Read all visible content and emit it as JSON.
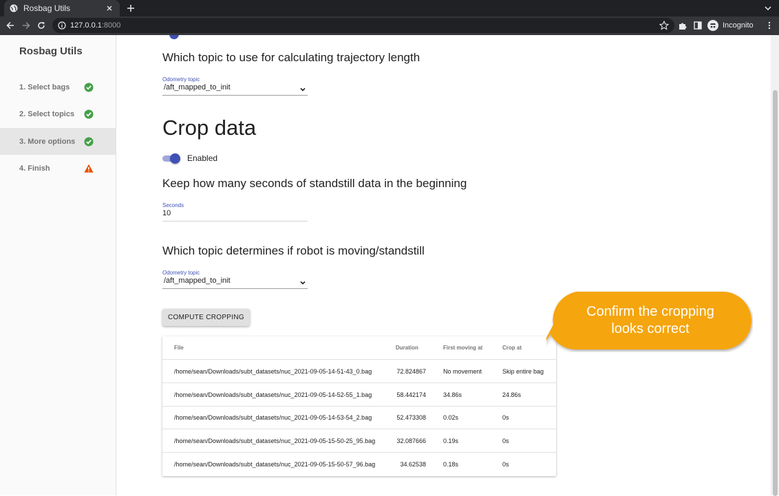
{
  "browser": {
    "tab_title": "Rosbag Utils",
    "url_host": "127.0.0.1",
    "url_port": ":8000",
    "profile_label": "Incognito"
  },
  "sidebar": {
    "title": "Rosbag Utils",
    "steps": [
      {
        "label": "1. Select bags",
        "status": "complete",
        "icon": "check-circle-icon",
        "color": "#43a047"
      },
      {
        "label": "2. Select topics",
        "status": "complete",
        "icon": "check-circle-icon",
        "color": "#43a047"
      },
      {
        "label": "3. More options",
        "status": "complete",
        "icon": "check-circle-icon",
        "color": "#43a047",
        "active": true
      },
      {
        "label": "4. Finish",
        "status": "warning",
        "icon": "warning-icon",
        "color": "#e65100"
      }
    ]
  },
  "main": {
    "trajectory_heading": "Which topic to use for calculating trajectory length",
    "trajectory_select": {
      "label": "Odometry topic",
      "value": "/aft_mapped_to_init"
    },
    "crop_heading": "Crop data",
    "crop_toggle": {
      "label": "Enabled",
      "checked": true
    },
    "standstill_heading": "Keep how many seconds of standstill data in the beginning",
    "seconds_field": {
      "label": "Seconds",
      "value": "10"
    },
    "moving_heading": "Which topic determines if robot is moving/standstill",
    "moving_select": {
      "label": "Odometry topic",
      "value": "/aft_mapped_to_init"
    },
    "compute_button": "COMPUTE CROPPING",
    "table": {
      "headers": {
        "file": "File",
        "duration": "Duration",
        "first_moving": "First moving at",
        "crop_at": "Crop at"
      },
      "rows": [
        {
          "file": "/home/sean/Downloads/subt_datasets/nuc_2021-09-05-14-51-43_0.bag",
          "duration": "72.824867",
          "first_moving": "No movement",
          "crop_at": "Skip entire bag"
        },
        {
          "file": "/home/sean/Downloads/subt_datasets/nuc_2021-09-05-14-52-55_1.bag",
          "duration": "58.442174",
          "first_moving": "34.86s",
          "crop_at": "24.86s"
        },
        {
          "file": "/home/sean/Downloads/subt_datasets/nuc_2021-09-05-14-53-54_2.bag",
          "duration": "52.473308",
          "first_moving": "0.02s",
          "crop_at": "0s"
        },
        {
          "file": "/home/sean/Downloads/subt_datasets/nuc_2021-09-05-15-50-25_95.bag",
          "duration": "32.087666",
          "first_moving": "0.19s",
          "crop_at": "0s"
        },
        {
          "file": "/home/sean/Downloads/subt_datasets/nuc_2021-09-05-15-50-57_96.bag",
          "duration": "34.62538",
          "first_moving": "0.18s",
          "crop_at": "0s"
        }
      ]
    }
  },
  "callout": {
    "text": "Confirm the cropping looks correct",
    "color": "#f5a50a"
  },
  "colors": {
    "accent": "#3f51b5",
    "success": "#43a047",
    "warning": "#e65100"
  }
}
